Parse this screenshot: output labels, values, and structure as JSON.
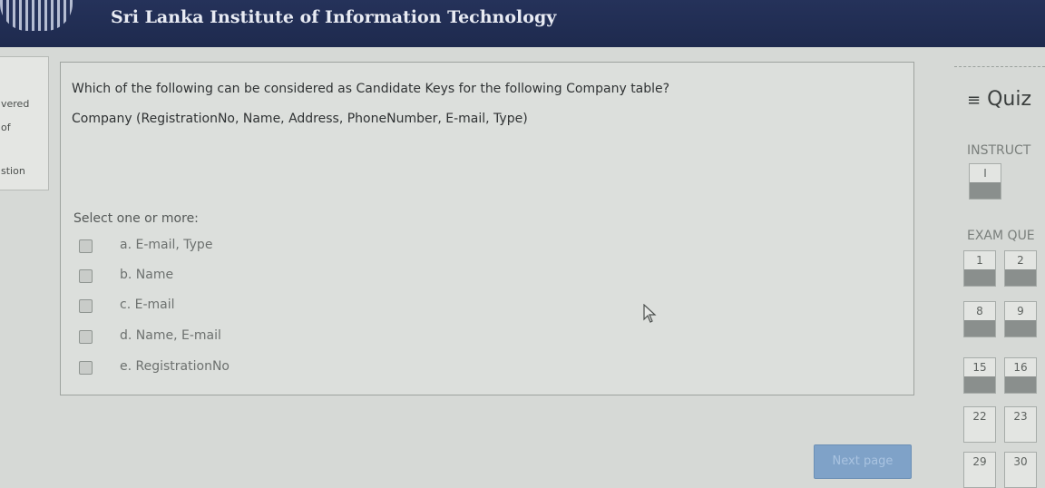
{
  "header": {
    "title": "Sri Lanka Institute of Information Technology"
  },
  "info": {
    "line1": "vered",
    "line2": "of",
    "line3": "stion"
  },
  "question": {
    "text": "Which of the following can be considered as Candidate Keys for the following Company table?",
    "schema": "Company (RegistrationNo, Name, Address, PhoneNumber, E-mail, Type)",
    "prompt": "Select one or more:",
    "options": [
      {
        "label": "a. E-mail, Type"
      },
      {
        "label": "b. Name"
      },
      {
        "label": "c. E-mail"
      },
      {
        "label": "d. Name, E-mail"
      },
      {
        "label": "e. RegistrationNo"
      }
    ]
  },
  "footer": {
    "next_label": "Next page"
  },
  "nav": {
    "title": "Quiz",
    "hamburger": "≡",
    "instructions_label": "INSTRUCT",
    "instructions_buttons": [
      "I"
    ],
    "exam_label": "EXAM QUE",
    "question_numbers": [
      "1",
      "2",
      "8",
      "9",
      "15",
      "16",
      "22",
      "23",
      "29",
      "30"
    ]
  }
}
